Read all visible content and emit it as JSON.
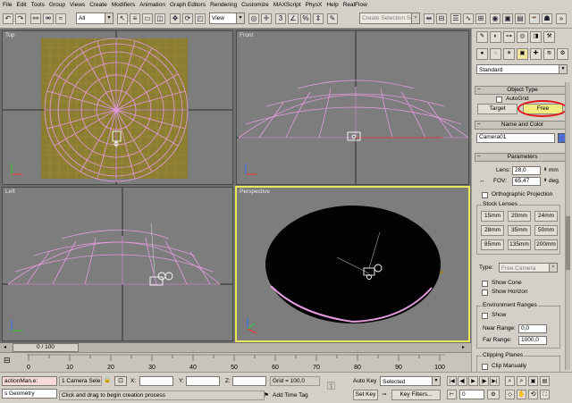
{
  "menu": [
    "File",
    "Edit",
    "Tools",
    "Group",
    "Views",
    "Create",
    "Modifiers",
    "Animation",
    "Graph Editors",
    "Rendering",
    "Customize",
    "MAXScript",
    "PhysX",
    "Help",
    "RealFlow"
  ],
  "toolbar": {
    "filter_value": "All",
    "view_value": "View",
    "selection_set_placeholder": "Create Selection Set"
  },
  "viewports": {
    "top": "Top",
    "front": "Front",
    "left": "Left",
    "perspective": "Perspective"
  },
  "command_panel": {
    "category": "Standard",
    "object_type_title": "Object Type",
    "autogrid": "AutoGrid",
    "target_button": "Target",
    "free_button": "Free",
    "name_color_title": "Name and Color",
    "object_name": "Camera01",
    "object_color": "#4f6fd0",
    "parameters_title": "Parameters",
    "lens_label": "Lens:",
    "lens_value": "28,0",
    "lens_unit": "mm",
    "fov_label": "FOV:",
    "fov_value": "65,47",
    "fov_unit": "deg.",
    "ortho": "Orthographic Projection",
    "stock_lenses_title": "Stock Lenses",
    "lenses": [
      "15mm",
      "20mm",
      "24mm",
      "28mm",
      "35mm",
      "50mm",
      "85mm",
      "135mm",
      "200mm"
    ],
    "type_label": "Type:",
    "type_value": "Free Camera",
    "show_cone": "Show Cone",
    "show_horizon": "Show Horizon",
    "env_ranges_title": "Environment Ranges",
    "env_show": "Show",
    "near_range_label": "Near Range:",
    "near_range_value": "0,0",
    "far_range_label": "Far Range:",
    "far_range_value": "1000,0",
    "clipping_title": "Clipping Planes",
    "clip_manually": "Clip Manually"
  },
  "timeline": {
    "frame_display": "0 / 100",
    "ticks": [
      "0",
      "10",
      "20",
      "30",
      "40",
      "50",
      "60",
      "70",
      "80",
      "90",
      "100"
    ]
  },
  "status": {
    "listener_line1": "actionMan.e:",
    "listener_line2": "s Geometry",
    "selection_info": "1 Camera Sele",
    "x_label": "X:",
    "y_label": "Y:",
    "z_label": "Z:",
    "grid": "Grid = 100,0",
    "prompt": "Click and drag to begin creation process",
    "add_time_tag": "Add Time Tag",
    "auto_key": "Auto Key",
    "auto_key_value": "Selected",
    "set_key": "Set Key",
    "key_filters": "Key Filters...",
    "frame_value": "0"
  }
}
